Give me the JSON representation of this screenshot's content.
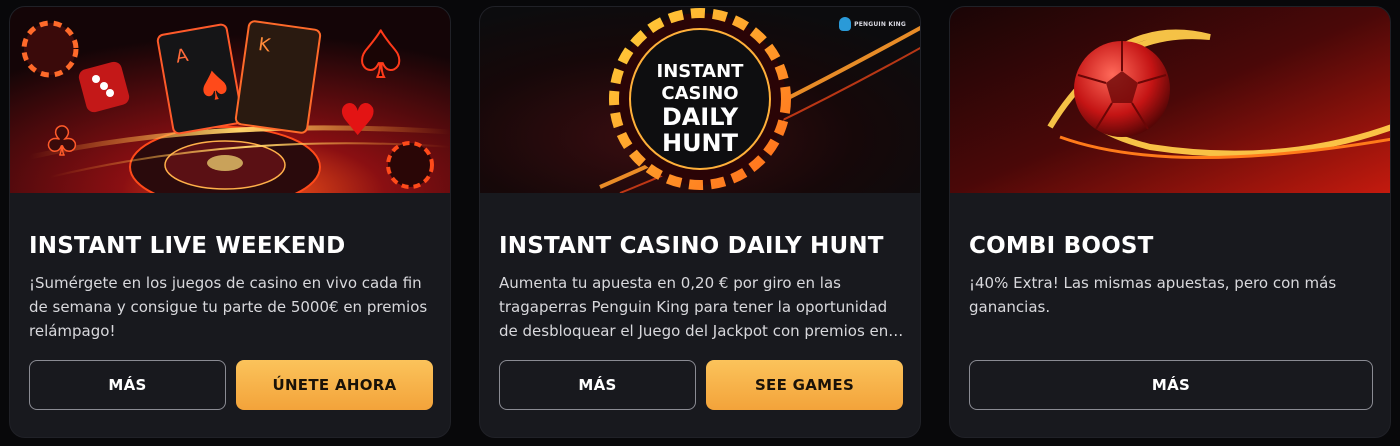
{
  "promotions": [
    {
      "title": "INSTANT LIVE WEEKEND",
      "description": "¡Sumérgete en los juegos de casino en vivo cada fin de semana y consigue tu parte de 5000€ en premios relámpago!",
      "more_label": "MÁS",
      "cta_label": "ÚNETE AHORA"
    },
    {
      "title": "INSTANT CASINO DAILY HUNT",
      "description": "Aumenta tu apuesta en 0,20 € por giro en las tragaperras Penguin King para tener la oportunidad de desbloquear el Juego del Jackpot con premios en efectivo",
      "banner_text": [
        "INSTANT",
        "CASINO",
        "DAILY",
        "HUNT"
      ],
      "provider_badge": "PENGUIN KING",
      "more_label": "MÁS",
      "cta_label": "SEE GAMES"
    },
    {
      "title": "COMBI BOOST",
      "description": "¡40% Extra! Las mismas apuestas, pero con más ganancias.",
      "more_label": "MÁS"
    }
  ],
  "colors": {
    "card_bg": "#18191e",
    "page_bg": "#08080a",
    "gold_button": "#f6ad42",
    "outline_border": "#8a8b93"
  }
}
